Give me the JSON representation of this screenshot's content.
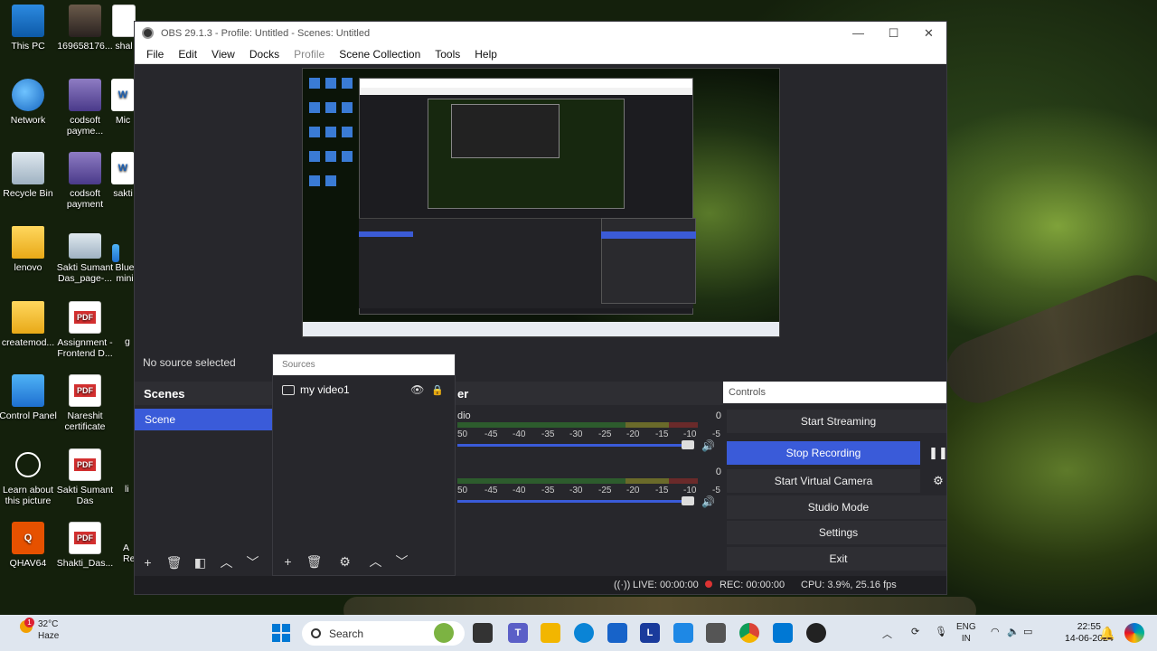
{
  "desktop": {
    "icons": [
      {
        "label": "This PC"
      },
      {
        "label": "169658176..."
      },
      {
        "label": "shal"
      },
      {
        "label": "Network"
      },
      {
        "label": "codsoft payme..."
      },
      {
        "label": "Mic"
      },
      {
        "label": "Recycle Bin"
      },
      {
        "label": "codsoft payment"
      },
      {
        "label": "sakti"
      },
      {
        "label": "lenovo"
      },
      {
        "label": "Sakti Sumant Das_page-..."
      },
      {
        "label": "Blue mini"
      },
      {
        "label": "createmod..."
      },
      {
        "label": "Assignment - Frontend D..."
      },
      {
        "label": "g"
      },
      {
        "label": "Control Panel"
      },
      {
        "label": "Nareshit certificate"
      },
      {
        "label": "Learn about this picture"
      },
      {
        "label": "Sakti Sumant Das"
      },
      {
        "label": "li"
      },
      {
        "label": "QHAV64"
      },
      {
        "label": "Shakti_Das..."
      },
      {
        "label": "A Re"
      }
    ],
    "pdf_badge": "PDF"
  },
  "obs": {
    "window_title": "OBS 29.1.3 - Profile: Untitled - Scenes: Untitled",
    "window_controls": {
      "minimize": "—",
      "maximize": "☐",
      "close": "✕"
    },
    "menu": [
      "File",
      "Edit",
      "View",
      "Docks",
      "Profile",
      "Scene Collection",
      "Tools",
      "Help"
    ],
    "no_source": "No source selected",
    "scenes": {
      "title": "Scenes",
      "items": [
        "Scene"
      ]
    },
    "sources": {
      "title": "Sources",
      "items": [
        {
          "name": "my video1",
          "visible_icon": "eye-icon",
          "lock_icon": "lock-icon"
        }
      ]
    },
    "mixer": {
      "title_fragment": "er",
      "channels": [
        {
          "name_fragment": "dio",
          "db": "0",
          "scale": [
            "50",
            "-45",
            "-40",
            "-35",
            "-30",
            "-25",
            "-20",
            "-15",
            "-10",
            "-5"
          ],
          "volume_level": 0.95
        },
        {
          "name_fragment": "",
          "db": "0",
          "scale": [
            "50",
            "-45",
            "-40",
            "-35",
            "-30",
            "-25",
            "-20",
            "-15",
            "-10",
            "-5"
          ],
          "volume_level": 0.95
        }
      ]
    },
    "controls": {
      "title": "Controls",
      "start_streaming": "Start Streaming",
      "stop_recording": "Stop Recording",
      "pause_icon": "pause-icon",
      "start_virtual_camera": "Start Virtual Camera",
      "settings_gear": "gear-icon",
      "studio_mode": "Studio Mode",
      "settings": "Settings",
      "exit": "Exit"
    },
    "status": {
      "live": "LIVE: 00:00:00",
      "rec": "REC: 00:00:00",
      "cpu": "CPU: 3.9%, 25.16 fps"
    },
    "toolbar_glyphs": {
      "add": "+",
      "remove": "🗑",
      "filters": "◧",
      "up": "︿",
      "down": "﹀",
      "props": "⚙"
    }
  },
  "taskbar": {
    "weather_temp": "32°C",
    "weather_desc": "Haze",
    "weather_badge": "1",
    "search_label": "Search",
    "lang": "ENG",
    "region": "IN",
    "time": "22:55",
    "date": "14-06-2024",
    "accent": "#0078d4"
  },
  "colors": {
    "obs_accent": "#3a5bd9",
    "rec_dot": "#dd3333"
  }
}
